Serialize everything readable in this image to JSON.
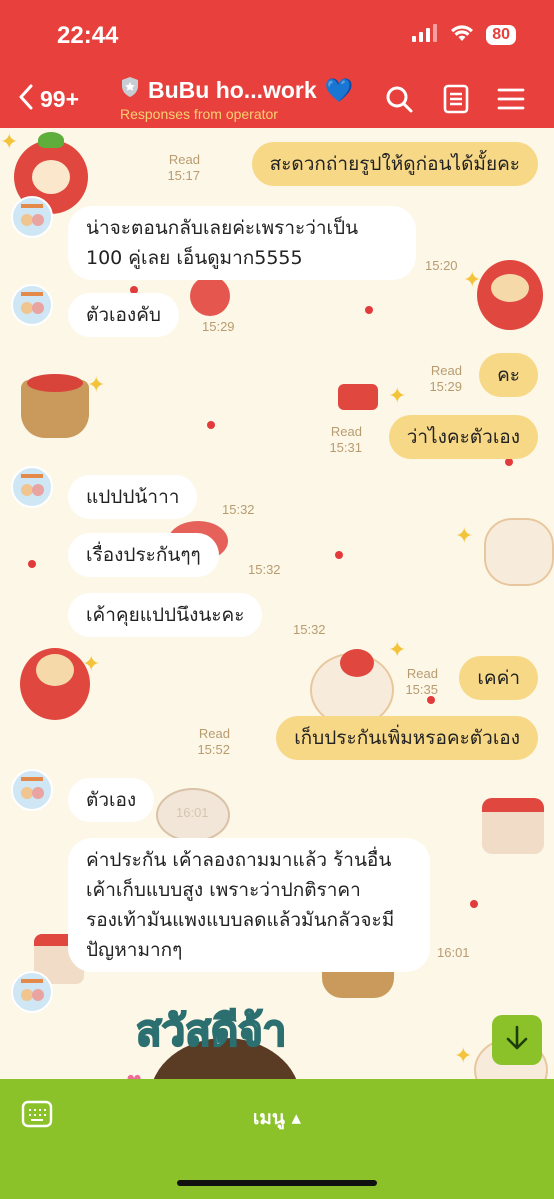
{
  "status_bar": {
    "time": "22:44",
    "battery": "80"
  },
  "header": {
    "back_count": "99+",
    "title": "BuBu ho...work",
    "heart": "💙",
    "subtitle": "Responses from operator",
    "icons": [
      "search-icon",
      "notes-icon",
      "menu-icon"
    ]
  },
  "messages": [
    {
      "side": "out",
      "text": "สะดวกถ่ายรูปให้ดูก่อนได้มั้ยคะ",
      "status": "Read",
      "time": "15:17"
    },
    {
      "side": "in",
      "text": "น่าจะตอนกลับเลยค่ะเพราะว่าเป็น 100 คู่เลย เอ็นดูมาก5555",
      "time": "15:20"
    },
    {
      "side": "in",
      "text": "ตัวเองคับ",
      "time": "15:29"
    },
    {
      "side": "out",
      "text": "คะ",
      "status": "Read",
      "time": "15:29"
    },
    {
      "side": "out",
      "text": "ว่าไงคะตัวเอง",
      "status": "Read",
      "time": "15:31"
    },
    {
      "side": "in",
      "text": "แปปปน้าาา",
      "time": "15:32"
    },
    {
      "side": "in",
      "text": "เรื่องประกันๆๆ",
      "time": "15:32"
    },
    {
      "side": "in",
      "text": "เค้าคุยแปปนึงนะคะ",
      "time": "15:32"
    },
    {
      "side": "out",
      "text": "เคค่า",
      "status": "Read",
      "time": "15:35"
    },
    {
      "side": "out",
      "text": "เก็บประกันเพิ่มหรอคะตัวเอง",
      "status": "Read",
      "time": "15:52"
    },
    {
      "side": "in",
      "text": "ตัวเอง",
      "time": "16:01"
    },
    {
      "side": "in",
      "text": "ค่าประกัน เค้าลองถามมาแล้ว ร้านอื่น เค้าเก็บแบบสูง เพราะว่าปกติราคารองเท้ามันแพงแบบลดแล้วมันกลัวจะมีปัญหามากๆ",
      "time": "16:01"
    }
  ],
  "sticker": {
    "text": "สวัสดีจ้า"
  },
  "bottom_bar": {
    "menu_label": "เมนู ▴"
  },
  "colors": {
    "header_red": "#e8413d",
    "outgoing_bubble": "#f7d887",
    "incoming_bubble": "#ffffff",
    "menu_green": "#8bc22a",
    "wallpaper": "#fdf7e7",
    "subtitle_yellow": "#f7d070"
  }
}
